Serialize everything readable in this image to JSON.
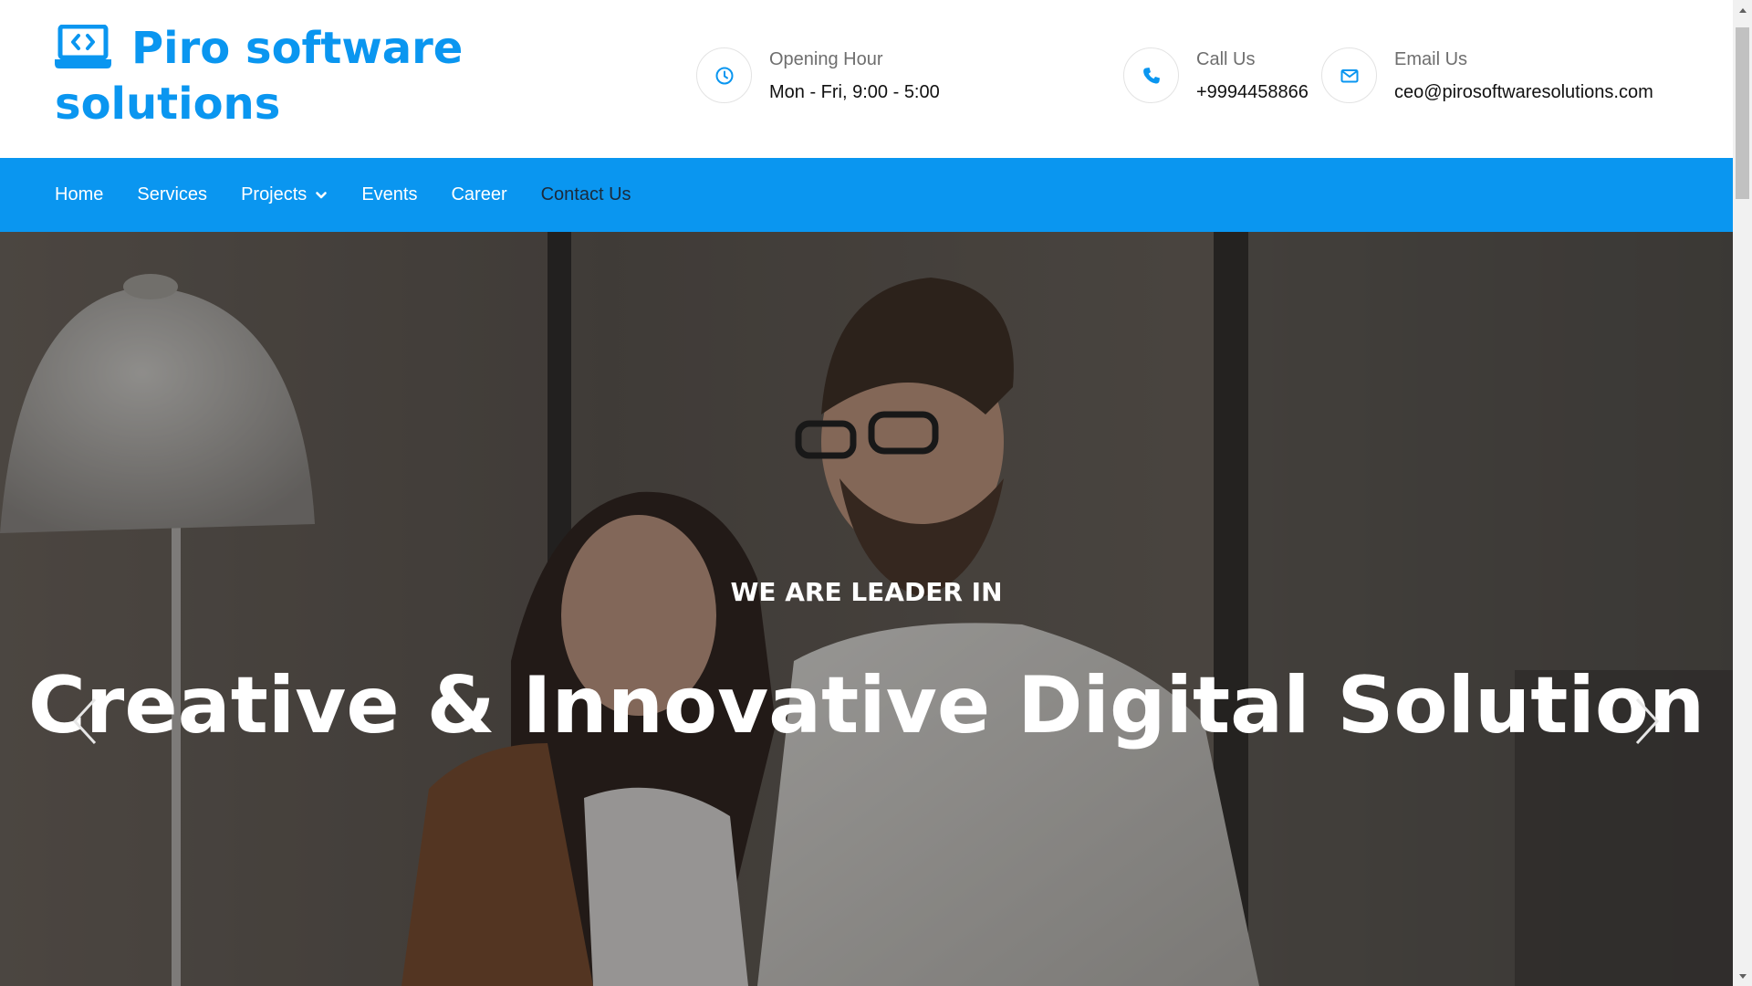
{
  "brand": {
    "name": "Piro software solutions",
    "color": "#0a96f0"
  },
  "header": {
    "hours": {
      "label": "Opening Hour",
      "value": "Mon - Fri, 9:00 - 5:00",
      "icon": "clock-icon"
    },
    "call": {
      "label": "Call Us",
      "value": "+9994458866",
      "icon": "phone-icon"
    },
    "email": {
      "label": "Email Us",
      "value": "ceo@pirosoftwaresolutions.com",
      "icon": "envelope-icon"
    }
  },
  "nav": {
    "items": [
      {
        "label": "Home"
      },
      {
        "label": "Services"
      },
      {
        "label": "Projects",
        "has_dropdown": true
      },
      {
        "label": "Events"
      },
      {
        "label": "Career"
      },
      {
        "label": "Contact Us"
      }
    ]
  },
  "hero": {
    "kicker": "WE ARE LEADER IN",
    "title": "Creative & Innovative Digital Solution"
  },
  "colors": {
    "accent": "#0a96f0",
    "nav_active_text": "#1b2a3a"
  }
}
